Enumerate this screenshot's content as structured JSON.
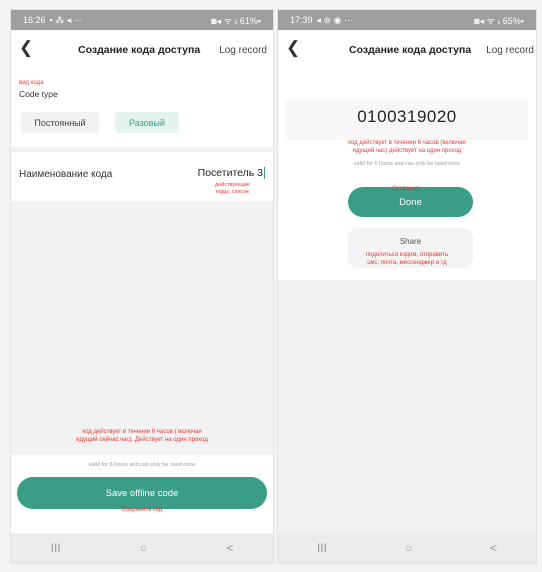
{
  "left": {
    "status": {
      "time": "16:26",
      "icons_left": "▪ ⁂ ◂ ···",
      "icons_right": "◙◂ ᯤ ᵢₗ 61%▪"
    },
    "header": {
      "title": "Создание кода доступа",
      "log": "Log record"
    },
    "annotation_code_type": "вид кода",
    "code_type_label": "Code type",
    "options": {
      "permanent": "Постоянный",
      "one_time": "Разовый"
    },
    "name_label": "Наименование кода",
    "name_value": "Посетитель 3",
    "annotation_active": [
      "действующие",
      "коды, список"
    ],
    "annotation_validity": [
      "код действует в течении 6 часов ( включая",
      "идущий сейчас час). Действует на один проход"
    ],
    "valid_note": "valid for 6 hours and can only be used once",
    "save_button": "Save offline code",
    "annotation_save": "Сохранить код"
  },
  "right": {
    "status": {
      "time": "17:39",
      "icons_left": "◂ ⊚ ◉ ···",
      "icons_right": "◙◂ ᯤ ᵢₗ 65%▪"
    },
    "header": {
      "title": "Создание кода доступа",
      "log": "Log record"
    },
    "code": "0100319020",
    "annotation_code": [
      "код действует в течении 6 часов (включая",
      "идущий час) действует на один проход"
    ],
    "valid_note": "valid for 6 hours and can only be used once",
    "annotation_done": "Сохранить",
    "done_button": "Done",
    "share_button": "Share",
    "annotation_share": [
      "поделиться кодом, отправить",
      "смс, почта, мессенджер и тд"
    ]
  },
  "nav": {
    "recents": "III",
    "home": "○",
    "back": "<"
  },
  "colors": {
    "accent": "#3a9d86",
    "accent_light": "#d9f0ea",
    "annotation": "#e53935"
  }
}
